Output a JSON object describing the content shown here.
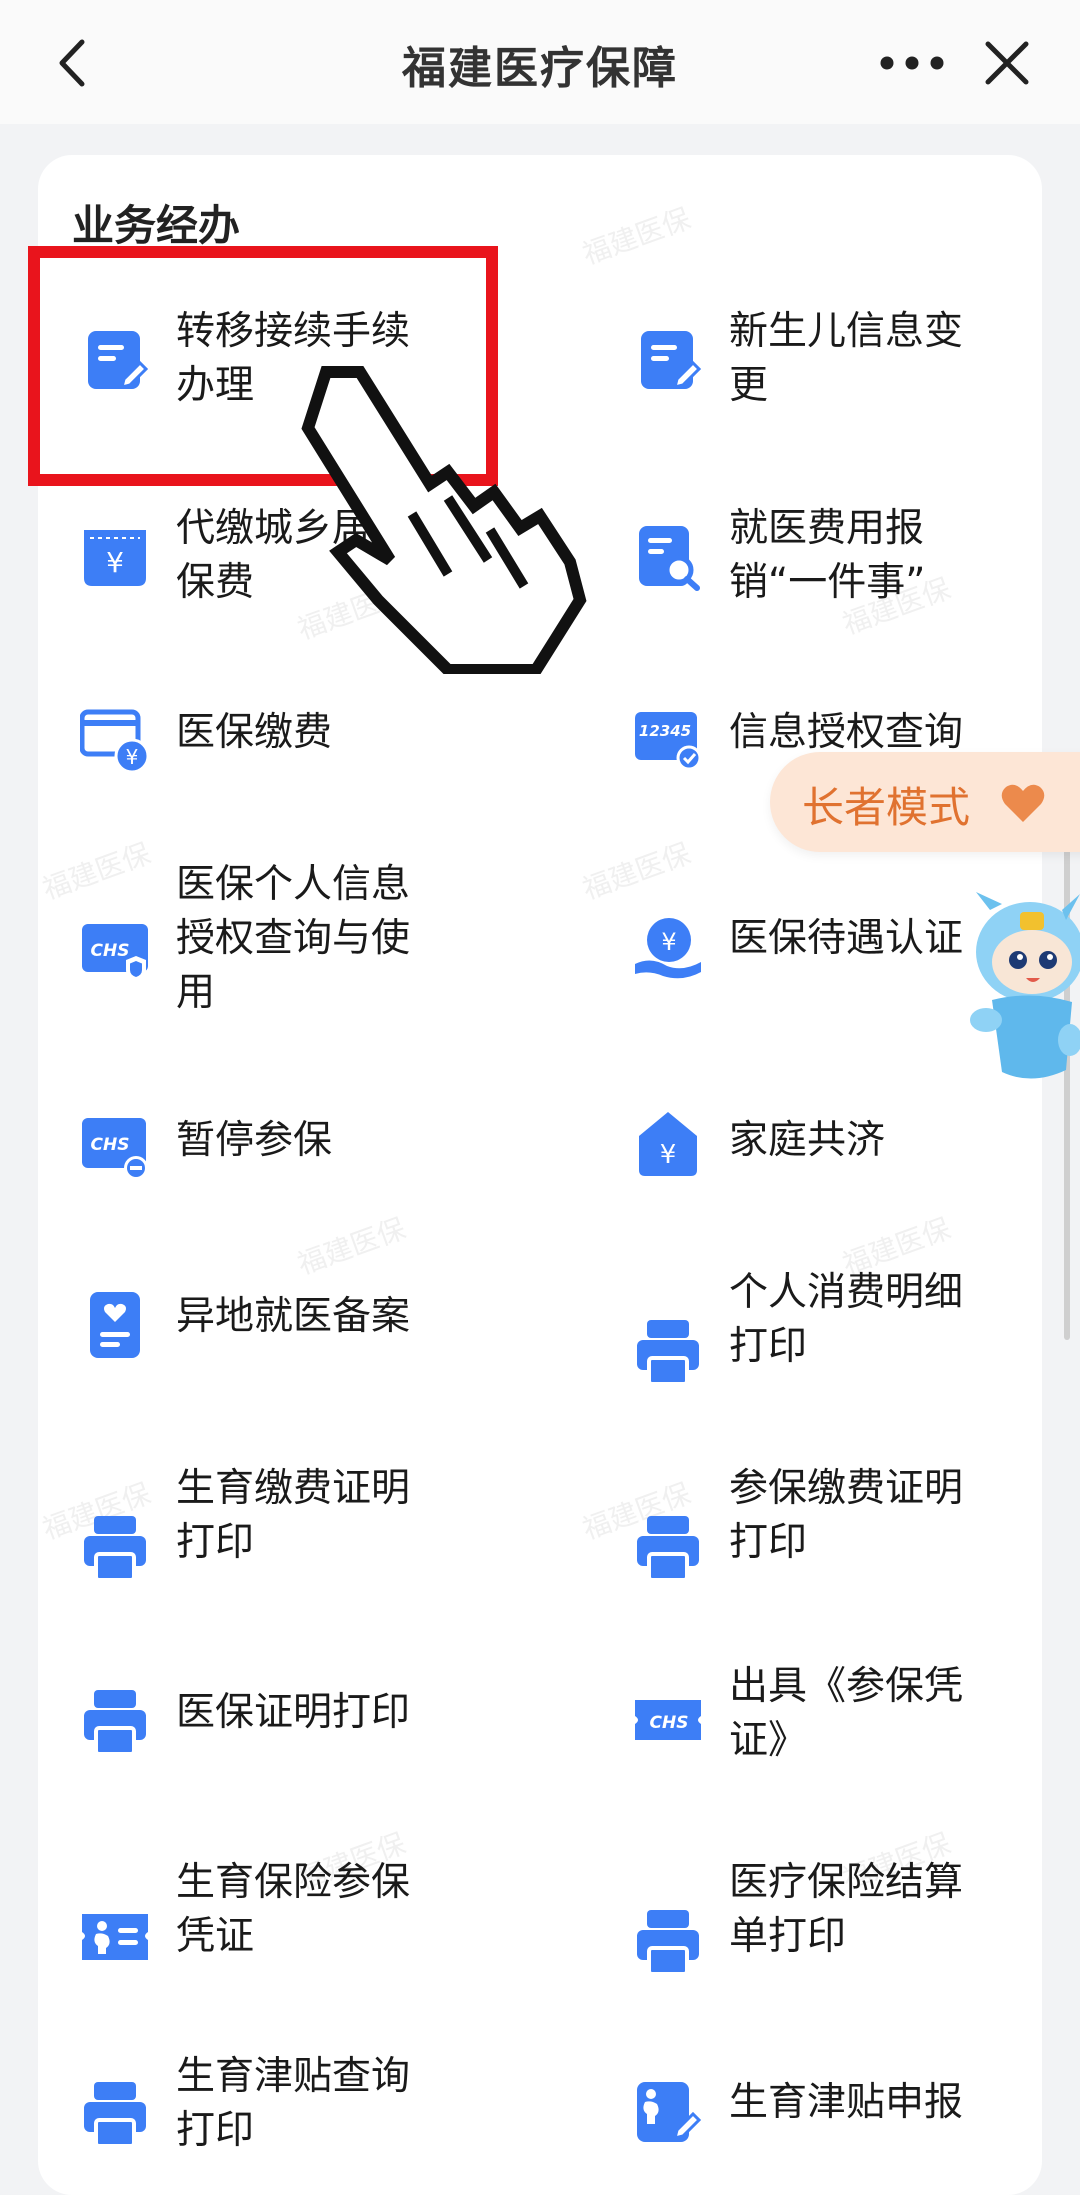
{
  "header": {
    "title": "福建医疗保障"
  },
  "section": {
    "title": "业务经办"
  },
  "watermark": "福建医保",
  "elder_mode": {
    "label": "长者模式"
  },
  "services": [
    {
      "label": "转移接续手续办理",
      "icon": "doc-edit-icon"
    },
    {
      "label": "新生儿信息变更",
      "icon": "doc-edit-icon"
    },
    {
      "label": "代缴城乡居民保费",
      "icon": "yuan-ticket-icon"
    },
    {
      "label": "就医费用报销“一件事”",
      "icon": "doc-search-icon"
    },
    {
      "label": "医保缴费",
      "icon": "card-yuan-icon"
    },
    {
      "label": "信息授权查询",
      "icon": "12345-card-icon"
    },
    {
      "label": "医保个人信息授权查询与使用",
      "icon": "chs-shield-icon"
    },
    {
      "label": "医保待遇认证",
      "icon": "hand-yuan-icon"
    },
    {
      "label": "暂停参保",
      "icon": "chs-minus-icon"
    },
    {
      "label": "家庭共济",
      "icon": "house-yuan-icon"
    },
    {
      "label": "异地就医备案",
      "icon": "doc-heart-icon"
    },
    {
      "label": "个人消费明细打印",
      "icon": "printer-icon"
    },
    {
      "label": "生育缴费证明打印",
      "icon": "printer-icon"
    },
    {
      "label": "参保缴费证明打印",
      "icon": "printer-icon"
    },
    {
      "label": "医保证明打印",
      "icon": "printer-icon"
    },
    {
      "label": "出具《参保凭证》",
      "icon": "chs-ticket-icon"
    },
    {
      "label": "生育保险参保凭证",
      "icon": "maternity-card-icon"
    },
    {
      "label": "医疗保险结算单打印",
      "icon": "printer-icon"
    },
    {
      "label": "生育津贴查询打印",
      "icon": "printer-icon"
    },
    {
      "label": "生育津贴申报",
      "icon": "maternity-edit-icon"
    }
  ],
  "colors": {
    "icon_blue": "#3d7ef6",
    "highlight_red": "#e9141c",
    "elder_orange": "#e07230"
  }
}
